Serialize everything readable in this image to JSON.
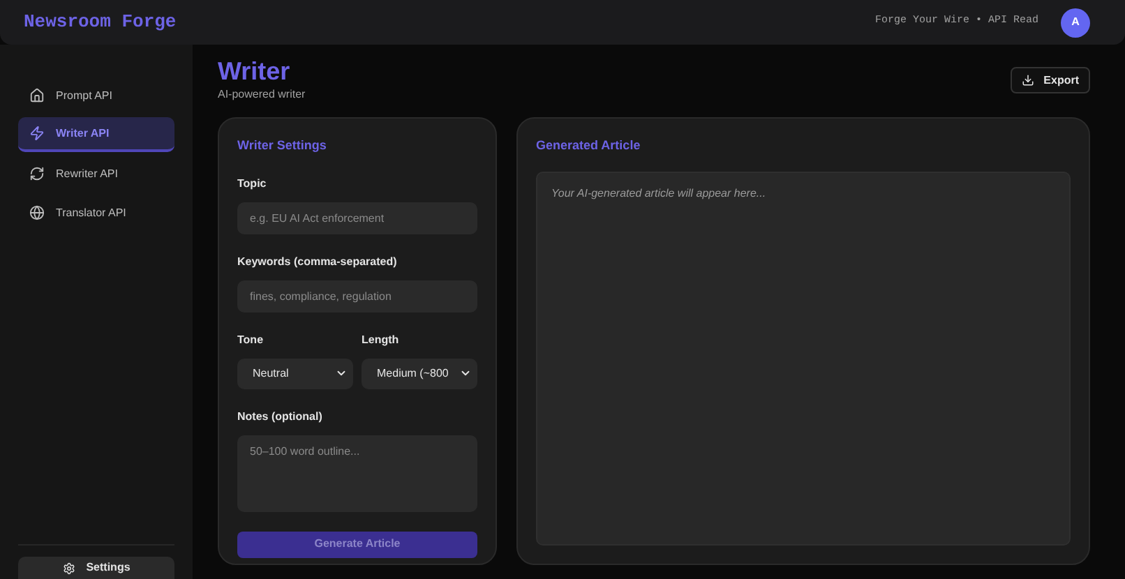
{
  "header": {
    "brand": "Newsroom Forge",
    "tagline": "Forge Your Wire • API Read",
    "avatar": "A"
  },
  "sidebar": {
    "items": [
      {
        "label": "Prompt API",
        "selected": false
      },
      {
        "label": "Writer API",
        "selected": true
      },
      {
        "label": "Rewriter API",
        "selected": false
      },
      {
        "label": "Translator API",
        "selected": false
      }
    ],
    "settings": "Settings"
  },
  "page": {
    "title": "Writer",
    "subtitle": "AI-powered writer",
    "export": "Export"
  },
  "settings_card": {
    "title": "Writer Settings",
    "topic": {
      "label": "Topic",
      "placeholder": "e.g. EU AI Act enforcement"
    },
    "keywords": {
      "label": "Keywords (comma-separated)",
      "placeholder": "fines, compliance, regulation"
    },
    "tone": {
      "label": "Tone",
      "value": "Neutral"
    },
    "length": {
      "label": "Length",
      "value": "Medium (~800"
    },
    "notes": {
      "label": "Notes (optional)",
      "placeholder": "50–100 word outline..."
    },
    "generate": {
      "label": "Generate Article",
      "disabled": true
    }
  },
  "article_card": {
    "title": "Generated Article",
    "placeholder": "Your AI-generated article will appear here..."
  }
}
